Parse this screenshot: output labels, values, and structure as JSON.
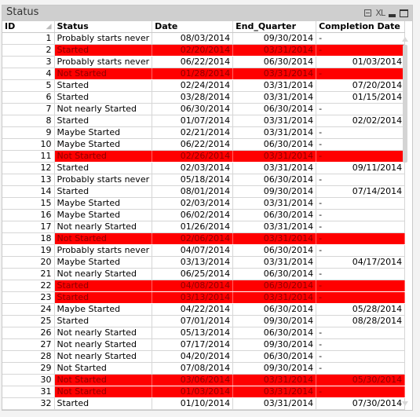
{
  "window": {
    "title": "Status",
    "icons": [
      "print-icon",
      "xl-export-icon",
      "minimize-icon",
      "maximize-icon"
    ],
    "xl_label": "XL"
  },
  "table": {
    "columns": [
      "ID",
      "Status",
      "Date",
      "End_Quarter",
      "Completion Date"
    ],
    "highlight_color": "#ff0000",
    "highlight_text_color": "#8b0000",
    "rows": [
      {
        "id": "1",
        "status": "Probably starts never",
        "date": "08/03/2014",
        "end_quarter": "09/30/2014",
        "completion": "-",
        "highlight": false
      },
      {
        "id": "2",
        "status": "Started",
        "date": "02/20/2014",
        "end_quarter": "03/31/2014",
        "completion": "-",
        "highlight": true
      },
      {
        "id": "3",
        "status": "Probably starts never",
        "date": "06/22/2014",
        "end_quarter": "06/30/2014",
        "completion": "01/03/2014",
        "highlight": false
      },
      {
        "id": "4",
        "status": "Not Started",
        "date": "01/28/2014",
        "end_quarter": "03/31/2014",
        "completion": "-",
        "highlight": true
      },
      {
        "id": "5",
        "status": "Started",
        "date": "02/24/2014",
        "end_quarter": "03/31/2014",
        "completion": "07/20/2014",
        "highlight": false
      },
      {
        "id": "6",
        "status": "Started",
        "date": "03/28/2014",
        "end_quarter": "03/31/2014",
        "completion": "01/15/2014",
        "highlight": false
      },
      {
        "id": "7",
        "status": "Not nearly Started",
        "date": "06/30/2014",
        "end_quarter": "06/30/2014",
        "completion": "-",
        "highlight": false
      },
      {
        "id": "8",
        "status": "Started",
        "date": "01/07/2014",
        "end_quarter": "03/31/2014",
        "completion": "02/02/2014",
        "highlight": false
      },
      {
        "id": "9",
        "status": "Maybe Started",
        "date": "02/21/2014",
        "end_quarter": "03/31/2014",
        "completion": "-",
        "highlight": false
      },
      {
        "id": "10",
        "status": "Maybe Started",
        "date": "06/22/2014",
        "end_quarter": "06/30/2014",
        "completion": "-",
        "highlight": false
      },
      {
        "id": "11",
        "status": "Not Started",
        "date": "02/26/2014",
        "end_quarter": "03/31/2014",
        "completion": "-",
        "highlight": true
      },
      {
        "id": "12",
        "status": "Started",
        "date": "02/03/2014",
        "end_quarter": "03/31/2014",
        "completion": "09/11/2014",
        "highlight": false
      },
      {
        "id": "13",
        "status": "Probably starts never",
        "date": "05/18/2014",
        "end_quarter": "06/30/2014",
        "completion": "-",
        "highlight": false
      },
      {
        "id": "14",
        "status": "Started",
        "date": "08/01/2014",
        "end_quarter": "09/30/2014",
        "completion": "07/14/2014",
        "highlight": false
      },
      {
        "id": "15",
        "status": "Maybe Started",
        "date": "02/03/2014",
        "end_quarter": "03/31/2014",
        "completion": "-",
        "highlight": false
      },
      {
        "id": "16",
        "status": "Maybe Started",
        "date": "06/02/2014",
        "end_quarter": "06/30/2014",
        "completion": "-",
        "highlight": false
      },
      {
        "id": "17",
        "status": "Not nearly Started",
        "date": "01/26/2014",
        "end_quarter": "03/31/2014",
        "completion": "-",
        "highlight": false
      },
      {
        "id": "18",
        "status": "Not Started",
        "date": "02/06/2014",
        "end_quarter": "03/31/2014",
        "completion": "-",
        "highlight": true
      },
      {
        "id": "19",
        "status": "Probably starts never",
        "date": "04/07/2014",
        "end_quarter": "06/30/2014",
        "completion": "-",
        "highlight": false
      },
      {
        "id": "20",
        "status": "Maybe Started",
        "date": "03/13/2014",
        "end_quarter": "03/31/2014",
        "completion": "04/17/2014",
        "highlight": false
      },
      {
        "id": "21",
        "status": "Not nearly Started",
        "date": "06/25/2014",
        "end_quarter": "06/30/2014",
        "completion": "-",
        "highlight": false
      },
      {
        "id": "22",
        "status": "Started",
        "date": "04/08/2014",
        "end_quarter": "06/30/2014",
        "completion": "-",
        "highlight": true
      },
      {
        "id": "23",
        "status": "Started",
        "date": "03/13/2014",
        "end_quarter": "03/31/2014",
        "completion": "-",
        "highlight": true
      },
      {
        "id": "24",
        "status": "Maybe Started",
        "date": "04/22/2014",
        "end_quarter": "06/30/2014",
        "completion": "05/28/2014",
        "highlight": false
      },
      {
        "id": "25",
        "status": "Started",
        "date": "07/01/2014",
        "end_quarter": "09/30/2014",
        "completion": "08/28/2014",
        "highlight": false
      },
      {
        "id": "26",
        "status": "Not nearly Started",
        "date": "05/13/2014",
        "end_quarter": "06/30/2014",
        "completion": "-",
        "highlight": false
      },
      {
        "id": "27",
        "status": "Not nearly Started",
        "date": "07/17/2014",
        "end_quarter": "09/30/2014",
        "completion": "-",
        "highlight": false
      },
      {
        "id": "28",
        "status": "Not nearly Started",
        "date": "04/20/2014",
        "end_quarter": "06/30/2014",
        "completion": "-",
        "highlight": false
      },
      {
        "id": "29",
        "status": "Not Started",
        "date": "07/08/2014",
        "end_quarter": "09/30/2014",
        "completion": "-",
        "highlight": false
      },
      {
        "id": "30",
        "status": "Not Started",
        "date": "03/06/2014",
        "end_quarter": "03/31/2014",
        "completion": "05/30/2014",
        "highlight": true
      },
      {
        "id": "31",
        "status": "Not Started",
        "date": "01/03/2014",
        "end_quarter": "03/31/2014",
        "completion": "-",
        "highlight": true
      },
      {
        "id": "32",
        "status": "Started",
        "date": "01/10/2014",
        "end_quarter": "03/31/2014",
        "completion": "07/30/2014",
        "highlight": false
      }
    ]
  }
}
